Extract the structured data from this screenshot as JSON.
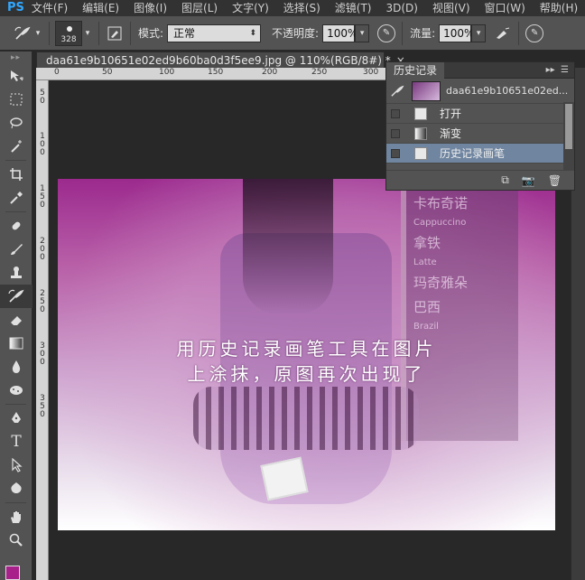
{
  "menubar": {
    "logo": "PS",
    "items": [
      "文件(F)",
      "编辑(E)",
      "图像(I)",
      "图层(L)",
      "文字(Y)",
      "选择(S)",
      "滤镜(T)",
      "3D(D)",
      "视图(V)",
      "窗口(W)",
      "帮助(H)"
    ]
  },
  "options": {
    "brush_size": "328",
    "mode_label": "模式:",
    "mode_value": "正常",
    "opacity_label": "不透明度:",
    "opacity_value": "100%",
    "flow_label": "流量:",
    "flow_value": "100%"
  },
  "document": {
    "tab_title": "daa61e9b10651e02ed9b60ba0d3f5ee9.jpg @ 110%(RGB/8#) *",
    "close": "×"
  },
  "ruler": {
    "top_labels": [
      "0",
      "50",
      "100",
      "150",
      "200",
      "250",
      "300"
    ],
    "left_labels": [
      "5",
      "0",
      "1",
      "0",
      "0",
      "1",
      "5",
      "0",
      "2",
      "0",
      "0",
      "2",
      "5",
      "0",
      "3",
      "0",
      "0",
      "3",
      "5",
      "0"
    ]
  },
  "image": {
    "caption_line1": "用历史记录画笔工具在图片",
    "caption_line2": "上涂抹，原图再次出现了",
    "board_text": [
      "卡布奇诺",
      "Cappuccino",
      "拿铁",
      "Latte",
      "玛奇雅朵",
      "巴西",
      "Brazil"
    ]
  },
  "history_panel": {
    "tab": "历史记录",
    "snapshot_name": "daa61e9b10651e02ed...",
    "items": [
      {
        "label": "打开",
        "selected": false
      },
      {
        "label": "渐变",
        "selected": false
      },
      {
        "label": "历史记录画笔",
        "selected": true
      }
    ]
  },
  "colors": {
    "foreground": "#a8208a",
    "selection": "#6f85a0",
    "ps_blue": "#31a8ff"
  }
}
